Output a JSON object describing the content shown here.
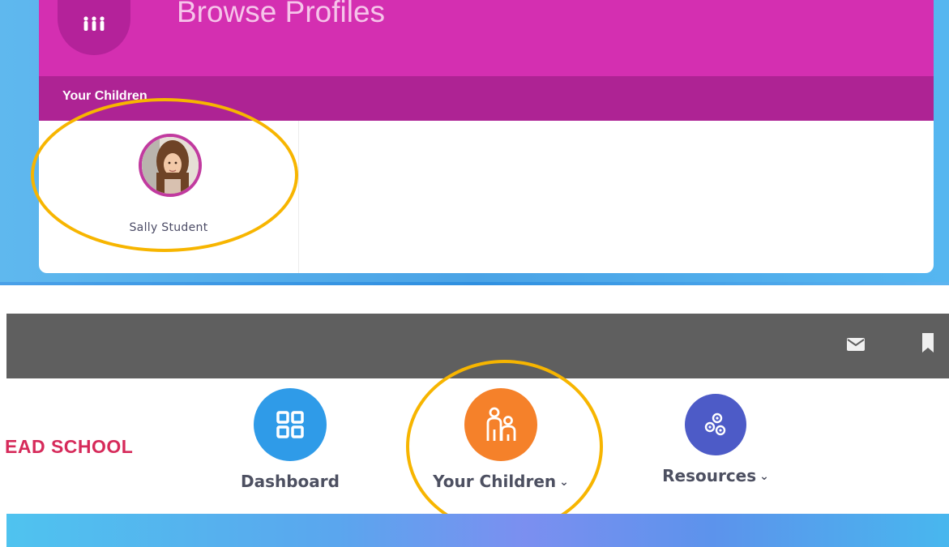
{
  "header": {
    "title": "Browse Profiles",
    "icon": "people-icon",
    "accent_color": "#d42fb1"
  },
  "section": {
    "label": "Your Children"
  },
  "profiles": [
    {
      "name": "Sally Student",
      "avatar": "student-photo"
    }
  ],
  "toolbar": {
    "icons": [
      "mail-icon",
      "bookmark-icon"
    ]
  },
  "school": {
    "name": "EAD SCHOOL"
  },
  "nav": {
    "items": [
      {
        "label": "Dashboard",
        "icon": "grid-icon",
        "color": "#2f9be8"
      },
      {
        "label": "Your Children",
        "icon": "children-icon",
        "color": "#f5812a",
        "has_dropdown": true
      },
      {
        "label": "Resources",
        "icon": "gears-icon",
        "color": "#4d5bc7",
        "has_dropdown": true
      }
    ]
  },
  "annotation_color": "#f7b500"
}
